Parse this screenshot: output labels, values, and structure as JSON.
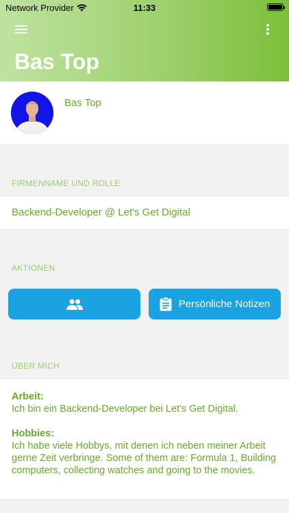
{
  "status_bar": {
    "carrier": "Network Provider",
    "time": "11:33"
  },
  "header": {
    "title": "Bas Top"
  },
  "profile": {
    "name": "Bas Top"
  },
  "sections": {
    "company_label": "FIRMENNAME UND ROLLE",
    "company_value": "Backend-Developer @ Let's Get Digital",
    "actions_label": "AKTIONEN",
    "about_label": "ÜBER MICH"
  },
  "actions": {
    "contacts_icon": "people-icon",
    "notes_icon": "clipboard-icon",
    "notes_label": "Persönliche Notizen"
  },
  "about": {
    "work_heading": "Arbeit:",
    "work_text": "Ich bin ein Backend-Developer bei Let's Get Digital.",
    "hobbies_heading": "Hobbies:",
    "hobbies_text": "Ich habe viele Hobbys, mit denen ich neben meiner Arbeit gerne Zeit verbringe. Some of them are: Formula 1, Building computers, collecting watches and going to the movies."
  },
  "colors": {
    "accent_green": "#6aa82d",
    "button_blue": "#1aa3e0",
    "avatar_bg": "#1414e6"
  }
}
